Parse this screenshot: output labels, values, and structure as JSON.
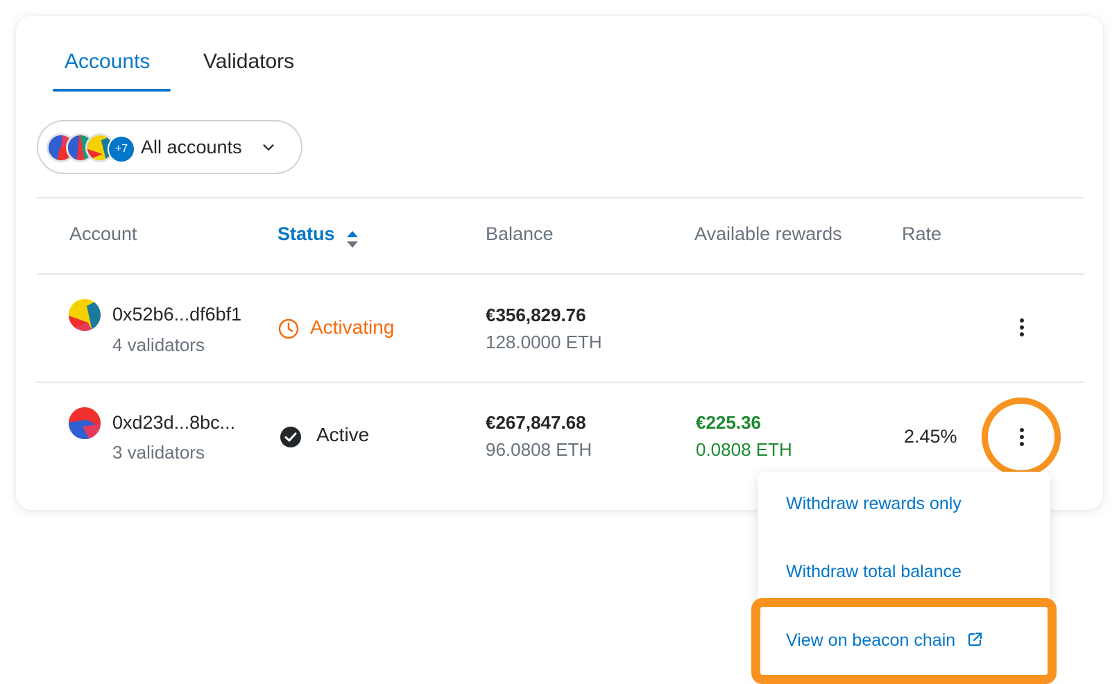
{
  "tabs": [
    {
      "label": "Accounts",
      "active": true
    },
    {
      "label": "Validators",
      "active": false
    }
  ],
  "account_selector": {
    "label": "All accounts",
    "extra_count": "+7",
    "icon": "chevron-down-icon"
  },
  "table": {
    "headers": {
      "account": "Account",
      "status": "Status",
      "balance": "Balance",
      "rewards": "Available rewards",
      "rate": "Rate"
    },
    "sorted_by": "status",
    "rows": [
      {
        "address": "0x52b6...df6bf1",
        "validators": "4 validators",
        "status": "Activating",
        "status_icon": "clock-icon",
        "balance_fiat": "€356,829.76",
        "balance_eth": "128.0000 ETH",
        "rewards_fiat": "",
        "rewards_eth": "",
        "rate": ""
      },
      {
        "address": "0xd23d...8bc...",
        "validators": "3 validators",
        "status": "Active",
        "status_icon": "check-circle-icon",
        "balance_fiat": "€267,847.68",
        "balance_eth": "96.0808 ETH",
        "rewards_fiat": "€225.36",
        "rewards_eth": "0.0808 ETH",
        "rate": "2.45%"
      }
    ]
  },
  "menu": {
    "items": [
      {
        "label": "Withdraw rewards only"
      },
      {
        "label": "Withdraw total balance"
      },
      {
        "label": "View on beacon chain",
        "icon": "external-link-icon"
      }
    ]
  },
  "colors": {
    "accent": "#0376c9",
    "activating": "#f66a0a",
    "rewards": "#1d8a2f",
    "highlight": "#f7931e"
  }
}
